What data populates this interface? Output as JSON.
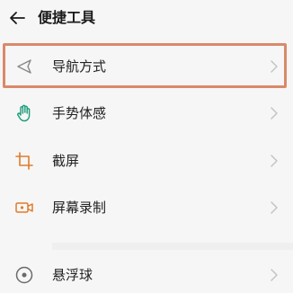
{
  "header": {
    "title": "便捷工具",
    "back_icon": "arrow-left-icon"
  },
  "items": [
    {
      "label": "导航方式",
      "icon": "navigation-triangle-icon",
      "icon_color": "#8a8a8a",
      "highlighted": true
    },
    {
      "label": "手势体感",
      "icon": "hand-gesture-icon",
      "icon_color": "#1a9a7a",
      "highlighted": false
    },
    {
      "label": "截屏",
      "icon": "crop-screenshot-icon",
      "icon_color": "#e07b2a",
      "highlighted": false
    },
    {
      "label": "屏幕录制",
      "icon": "screen-record-icon",
      "icon_color": "#e07b2a",
      "highlighted": false
    },
    {
      "label": "悬浮球",
      "icon": "floating-ball-icon",
      "icon_color": "#6a6a6a",
      "highlighted": false
    }
  ],
  "colors": {
    "highlight_border": "#d9896a",
    "chevron": "#c4c4c4"
  }
}
